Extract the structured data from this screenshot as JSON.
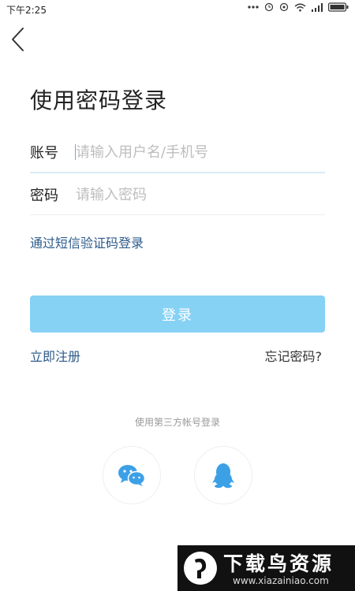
{
  "status_bar": {
    "time": "下午2:25",
    "icons": [
      "more-icon",
      "alarm-icon",
      "signal-icon",
      "wifi-icon",
      "cell-signal-icon",
      "battery-icon"
    ]
  },
  "header": {
    "back_icon": "chevron-left-icon"
  },
  "title": "使用密码登录",
  "form": {
    "account_label": "账号",
    "account_placeholder": "请输入用户名/手机号",
    "password_label": "密码",
    "password_placeholder": "请输入密码"
  },
  "sms_login_link": "通过短信验证码登录",
  "login_button": "登录",
  "register_link": "立即注册",
  "forgot_password_link": "忘记密码?",
  "third_party": {
    "label": "使用第三方帐号登录",
    "providers": [
      "wechat-icon",
      "qq-icon"
    ]
  },
  "watermark": {
    "title": "下载鸟资源",
    "url": "www.xiazainiao.com"
  },
  "colors": {
    "accent_link": "#2c5a8a",
    "login_button_bg": "#86d2f5",
    "social_icon": "#3ca0e6",
    "input_underline_active": "#d9ecf6"
  }
}
